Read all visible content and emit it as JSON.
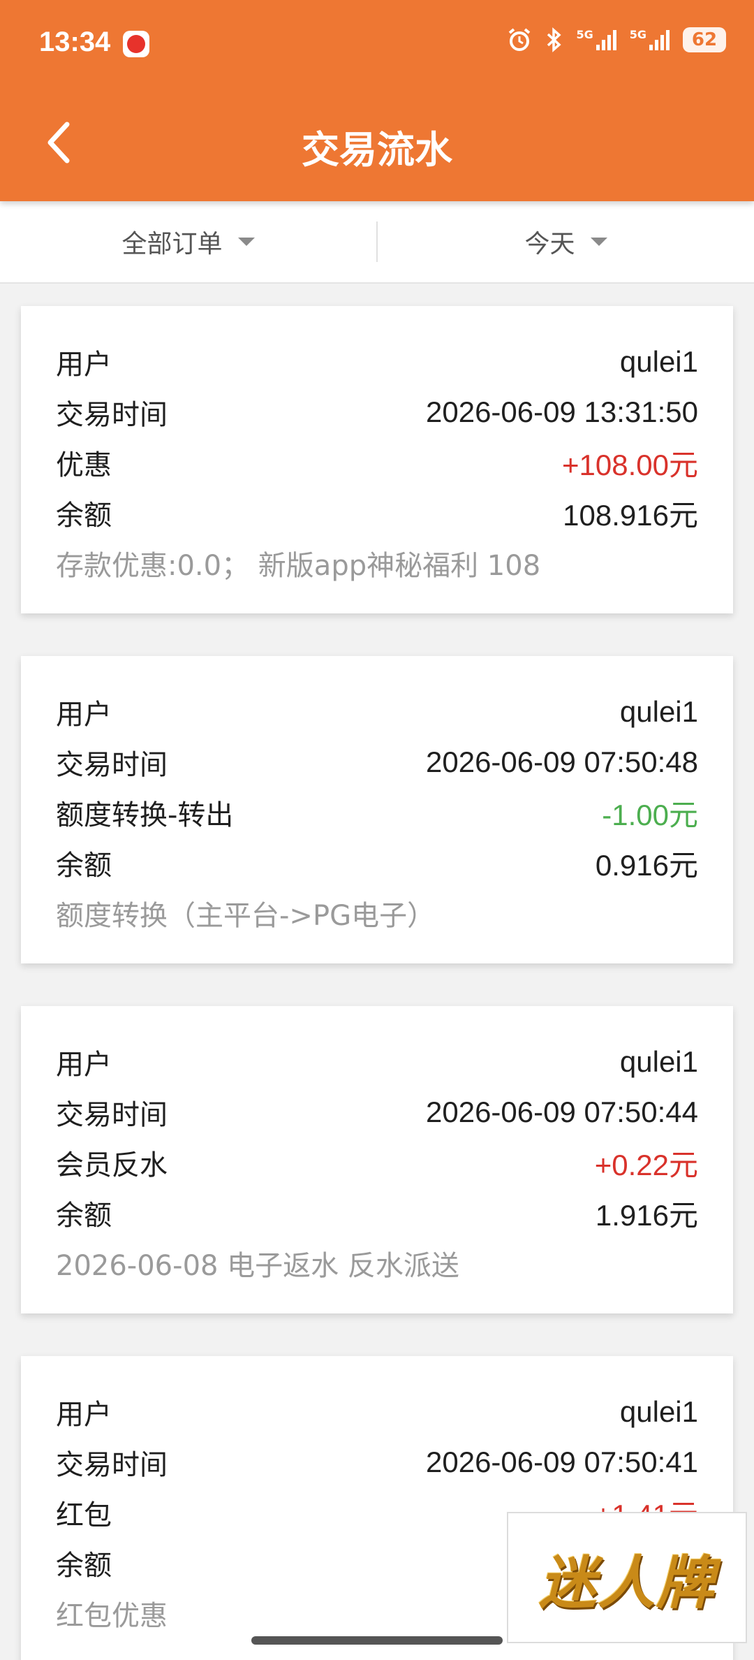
{
  "status_bar": {
    "time": "13:34",
    "signal1_label": "5G",
    "signal2_label": "5G",
    "battery": "62"
  },
  "header": {
    "title": "交易流水"
  },
  "filters": {
    "order_type": "全部订单",
    "date_range": "今天"
  },
  "transactions": [
    {
      "user_label": "用户",
      "user_value": "qulei1",
      "time_label": "交易时间",
      "time_value": "2026-06-09 13:31:50",
      "type_label": "优惠",
      "amount": "+108.00元",
      "balance_label": "余额",
      "balance_value": "108.916元",
      "remark": "存款优惠:0.0； 新版app神秘福利 108"
    },
    {
      "user_label": "用户",
      "user_value": "qulei1",
      "time_label": "交易时间",
      "time_value": "2026-06-09 07:50:48",
      "type_label": "额度转换-转出",
      "amount": "-1.00元",
      "balance_label": "余额",
      "balance_value": "0.916元",
      "remark": "额度转换（主平台->PG电子）"
    },
    {
      "user_label": "用户",
      "user_value": "qulei1",
      "time_label": "交易时间",
      "time_value": "2026-06-09 07:50:44",
      "type_label": "会员反水",
      "amount": "+0.22元",
      "balance_label": "余额",
      "balance_value": "1.916元",
      "remark": "2026-06-08 电子返水 反水派送"
    },
    {
      "user_label": "用户",
      "user_value": "qulei1",
      "time_label": "交易时间",
      "time_value": "2026-06-09 07:50:41",
      "type_label": "红包",
      "amount": "+1.41元",
      "balance_label": "余额",
      "balance_value": "",
      "remark": "红包优惠"
    }
  ],
  "watermark": {
    "text": "迷人牌"
  },
  "colors": {
    "brand": "#ee7733",
    "positive": "#d9322b",
    "negative": "#4cae4f"
  }
}
